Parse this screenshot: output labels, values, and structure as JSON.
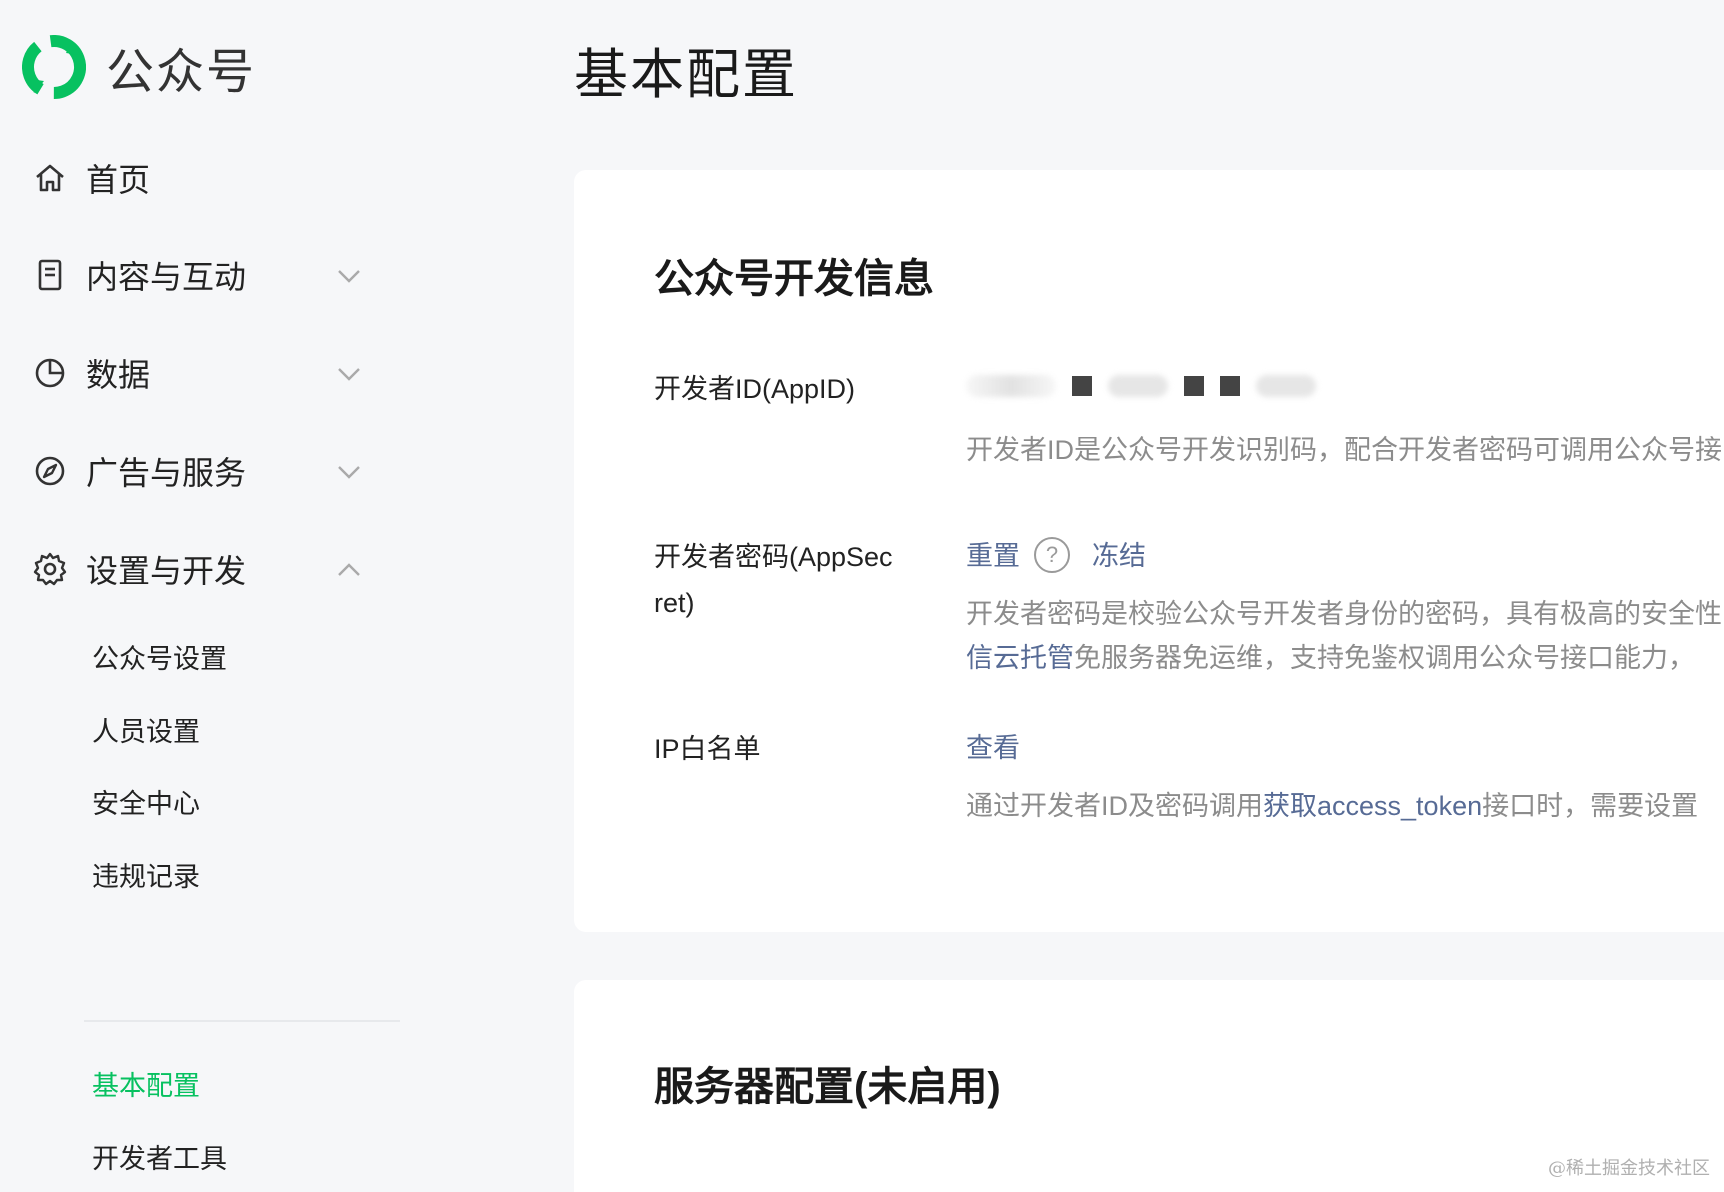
{
  "app": {
    "name": "公众号"
  },
  "colors": {
    "accent": "#07c160",
    "link": "#576b95",
    "muted": "#8c8c8c",
    "background": "#f6f7f9"
  },
  "sidebar": {
    "items": [
      {
        "label": "首页",
        "icon": "home-icon"
      },
      {
        "label": "内容与互动",
        "icon": "document-icon",
        "chevron": "chevron-down-icon"
      },
      {
        "label": "数据",
        "icon": "pie-chart-icon",
        "chevron": "chevron-down-icon"
      },
      {
        "label": "广告与服务",
        "icon": "compass-icon",
        "chevron": "chevron-down-icon"
      },
      {
        "label": "设置与开发",
        "icon": "gear-icon",
        "chevron": "chevron-up-icon"
      }
    ],
    "sub_items": [
      {
        "label": "公众号设置"
      },
      {
        "label": "人员设置"
      },
      {
        "label": "安全中心"
      },
      {
        "label": "违规记录"
      },
      {
        "label": "基本配置",
        "active": true
      },
      {
        "label": "开发者工具"
      }
    ]
  },
  "main": {
    "title": "基本配置",
    "dev_info": {
      "title": "公众号开发信息",
      "appid": {
        "label": "开发者ID(AppID)",
        "desc": "开发者ID是公众号开发识别码，配合开发者密码可调用公众号接"
      },
      "secret": {
        "label_line1": "开发者密码(AppSec",
        "label_line2": "ret)",
        "reset": "重置",
        "help": "?",
        "freeze": "冻结",
        "desc_line1": "开发者密码是校验公众号开发者身份的密码，具有极高的安全性",
        "desc_link": "信云托管",
        "desc_line2": "免服务器免运维，支持免鉴权调用公众号接口能力，"
      },
      "ip": {
        "label": "IP白名单",
        "view": "查看",
        "desc_pre": "通过开发者ID及密码调用",
        "desc_link": "获取access_token",
        "desc_post": "接口时，需要设置"
      }
    },
    "server": {
      "title": "服务器配置(未启用)"
    }
  },
  "watermark": "@稀土掘金技术社区"
}
